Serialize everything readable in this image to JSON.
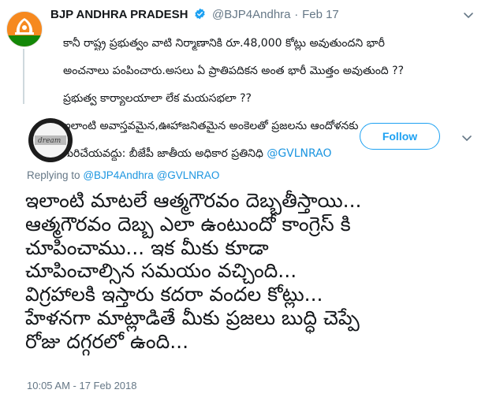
{
  "quoted_tweet": {
    "author_name": "BJP ANDHRA PRADESH",
    "handle": "@BJP4Andhra",
    "separator": "·",
    "date": "Feb 17",
    "text_lines": [
      "కానీ రాష్ట్ర ప్రభుత్వం వాటి నిర్మాణానికి రూ.48,000 కోట్లు అవుతుందని భారీ",
      "అంచనాలు పంపించారు.అసలు ఏ ప్రాతిపదికన అంత భారీ మొత్తం అవుతుంది ??",
      "ప్రభుత్వ కార్యాలయాలా లేక మయసభలా ??",
      "ఇలాంటి అవాస్తవమైన,ఊహాజనితమైన అంకెలతో ప్రజలను ఆందోళనకు",
      "గురిచేయవద్దు: బీజేపీ జాతీయ అధికార ప్రతినిధి "
    ],
    "text_mention": "@GVLNRAO"
  },
  "author_row": {
    "follow_label": "Follow"
  },
  "reply": {
    "replying_prefix": "Replying to",
    "mention1": "@BJP4Andhra",
    "mention2": "@GVLNRAO",
    "text_lines": [
      "ఇలాంటి మాటలే ఆత్మగౌరవం దెబ్బతీస్తాయి...",
      "ఆత్మగౌరవం దెబ్బ ఎలా ఉంటుందో కాంగ్రెస్ కి",
      "చూపించాము... ఇక మీకు కూడా",
      "చూపించాల్సిన సమయం వచ్చింది...",
      "విగ్రహాలకి ఇస్తారు కదరా వందల కోట్లు...",
      "హేళనగా మాట్లాడితే మీకు ప్రజలు బుద్ధి చెప్పే",
      "రోజు దగ్గరలో ఉంది..."
    ],
    "timestamp": "10:05 AM - 17 Feb 2018"
  },
  "colors": {
    "accent": "#1da1f2",
    "mention": "#1b95e0",
    "muted": "#657786",
    "bjp_orange": "#f6891f",
    "bjp_green": "#138808"
  },
  "icons": [
    "bjp-logo-icon",
    "verified-badge-icon",
    "chevron-down-icon",
    "user-avatar"
  ]
}
